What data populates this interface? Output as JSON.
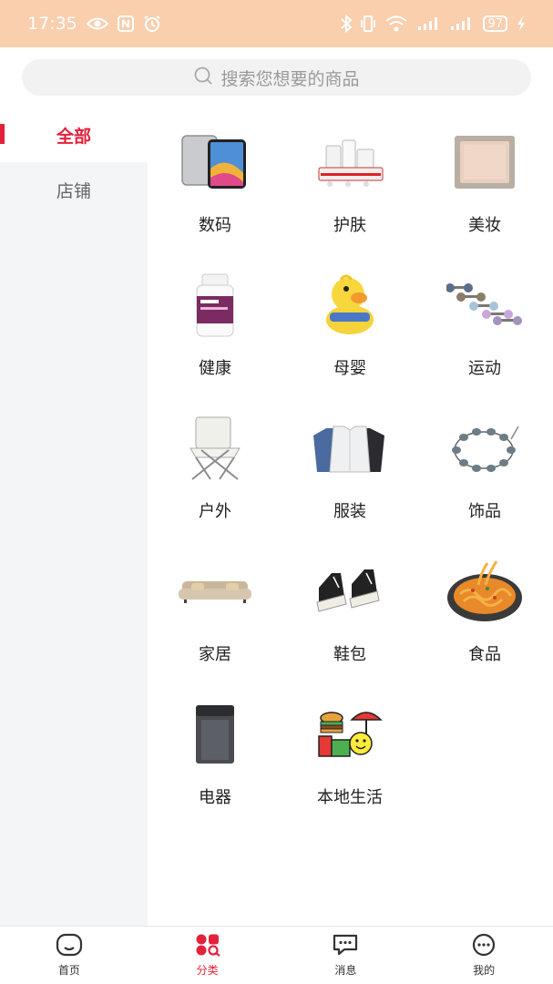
{
  "status_bar": {
    "time": "17:35",
    "battery": "97",
    "icons": [
      "eye-icon",
      "nfc-icon",
      "alarm-icon",
      "bluetooth-icon",
      "vibrate-icon",
      "wifi-icon",
      "signal-icon",
      "signal-icon",
      "charging-icon"
    ]
  },
  "search": {
    "placeholder": "搜索您想要的商品",
    "icon": "search-icon"
  },
  "sidebar": {
    "items": [
      {
        "label": "全部",
        "active": true
      },
      {
        "label": "店铺",
        "active": false
      }
    ]
  },
  "categories": [
    {
      "label": "数码",
      "icon": "tablet-icon"
    },
    {
      "label": "护肤",
      "icon": "skincare-set-icon"
    },
    {
      "label": "美妆",
      "icon": "compact-powder-icon"
    },
    {
      "label": "健康",
      "icon": "supplement-bottle-icon"
    },
    {
      "label": "母婴",
      "icon": "duck-potty-icon"
    },
    {
      "label": "运动",
      "icon": "dumbbell-icon"
    },
    {
      "label": "户外",
      "icon": "camping-chair-icon"
    },
    {
      "label": "服装",
      "icon": "jackets-icon"
    },
    {
      "label": "饰品",
      "icon": "bracelet-icon"
    },
    {
      "label": "家居",
      "icon": "sofa-icon"
    },
    {
      "label": "鞋包",
      "icon": "sneakers-icon"
    },
    {
      "label": "食品",
      "icon": "noodles-icon"
    },
    {
      "label": "电器",
      "icon": "washing-machine-icon"
    },
    {
      "label": "本地生活",
      "icon": "local-life-icon"
    }
  ],
  "tabbar": {
    "items": [
      {
        "label": "首页",
        "icon": "home-icon",
        "active": false
      },
      {
        "label": "分类",
        "icon": "category-icon",
        "active": true
      },
      {
        "label": "消息",
        "icon": "message-icon",
        "active": false
      },
      {
        "label": "我的",
        "icon": "profile-icon",
        "active": false
      }
    ]
  },
  "colors": {
    "accent": "#e3213b",
    "status_bar": "#f9cfae",
    "sidebar_bg": "#f4f5f7"
  }
}
